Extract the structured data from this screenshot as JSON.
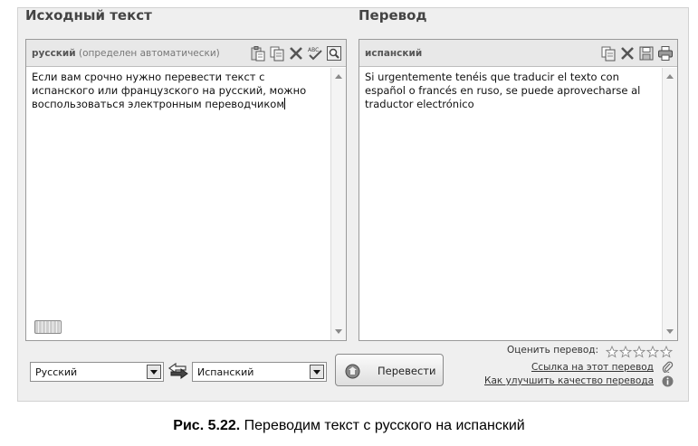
{
  "source": {
    "heading": "Исходный текст",
    "language": "русский",
    "detected_hint": "(определен автоматически)",
    "text": "Если вам срочно нужно перевести текст с испанского или французского на русский, можно воспользоваться электронным переводчиком",
    "tools": [
      "paste-icon",
      "copy-icon",
      "clear-icon",
      "spellcheck-icon",
      "zoom-icon"
    ]
  },
  "target": {
    "heading": "Перевод",
    "language": "испанский",
    "text": "Si urgentemente tenéis que traducir el texto con español o francés en ruso, se puede aprovecharse al traductor electrónico",
    "tools": [
      "copy-icon",
      "clear-icon",
      "save-icon",
      "print-icon"
    ]
  },
  "controls": {
    "from_language": "Русский",
    "to_language": "Испанский",
    "translate_label": "Перевести"
  },
  "feedback": {
    "rate_label": "Оценить перевод:",
    "rating": 0,
    "max_rating": 5,
    "link_label": "Ссылка на этот перевод",
    "improve_label": "Как улучшить качество перевода"
  },
  "caption": {
    "figure": "Рис. 5.22.",
    "text": "Переводим текст с русского на испанский"
  }
}
